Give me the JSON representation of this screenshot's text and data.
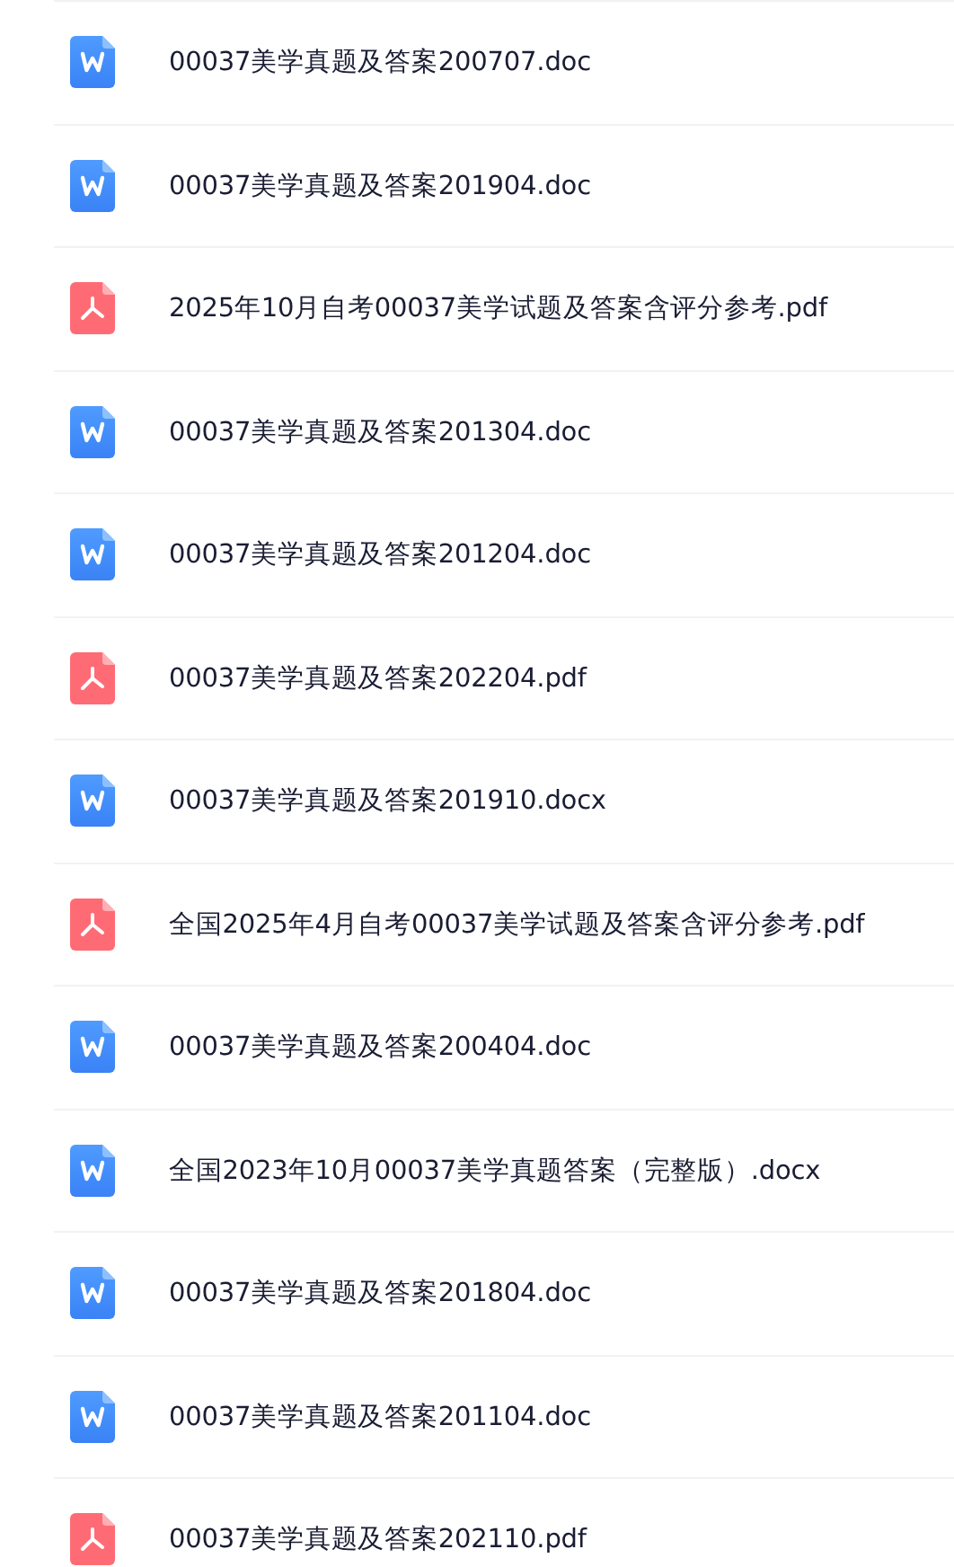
{
  "files": [
    {
      "kind": "word",
      "name": "00037美学真题及答案200707.doc"
    },
    {
      "kind": "word",
      "name": "00037美学真题及答案201904.doc"
    },
    {
      "kind": "pdf",
      "name": "2025年10月自考00037美学试题及答案含评分参考.pdf"
    },
    {
      "kind": "word",
      "name": "00037美学真题及答案201304.doc"
    },
    {
      "kind": "word",
      "name": "00037美学真题及答案201204.doc"
    },
    {
      "kind": "pdf",
      "name": "00037美学真题及答案202204.pdf"
    },
    {
      "kind": "word",
      "name": "00037美学真题及答案201910.docx"
    },
    {
      "kind": "pdf",
      "name": "全国2025年4月自考00037美学试题及答案含评分参考.pdf"
    },
    {
      "kind": "word",
      "name": "00037美学真题及答案200404.doc"
    },
    {
      "kind": "word",
      "name": "全国2023年10月00037美学真题答案（完整版）.docx"
    },
    {
      "kind": "word",
      "name": "00037美学真题及答案201804.doc"
    },
    {
      "kind": "word",
      "name": "00037美学真题及答案201104.doc"
    },
    {
      "kind": "pdf",
      "name": "00037美学真题及答案202110.pdf"
    }
  ]
}
